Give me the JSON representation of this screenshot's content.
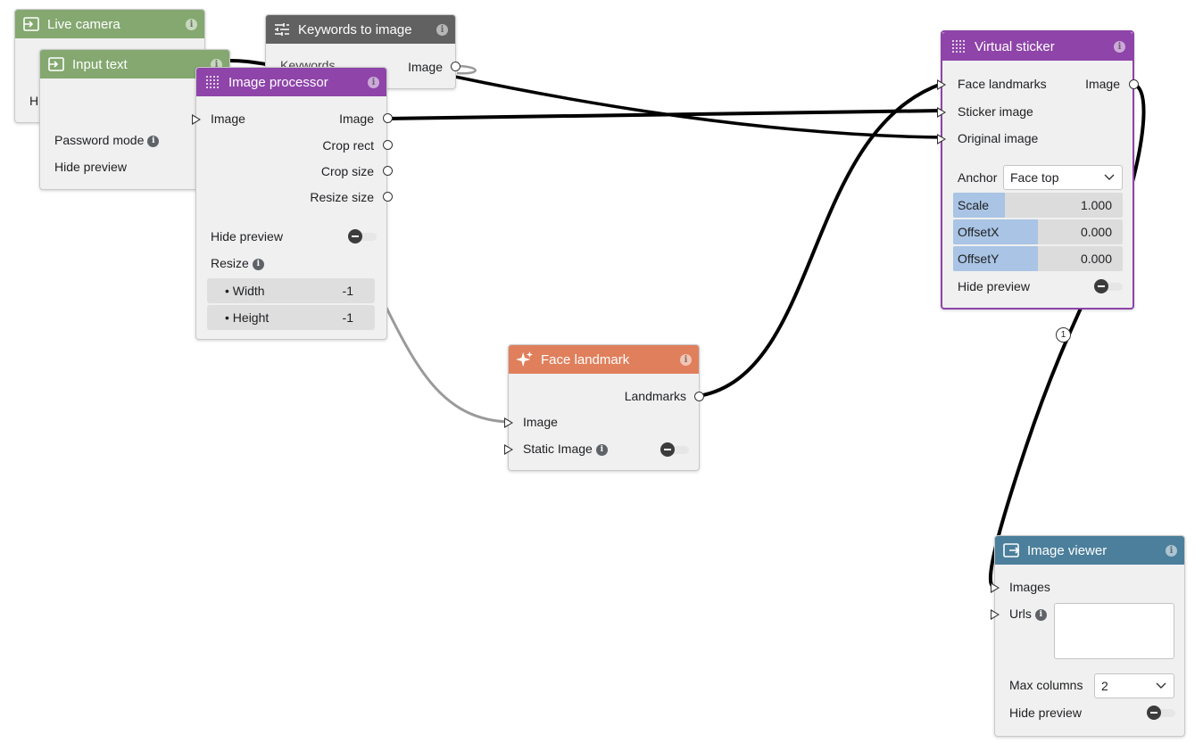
{
  "colors": {
    "input": "#84a870",
    "processor": "#8e44a9",
    "keywords": "#616161",
    "landmark": "#e07f5c",
    "viewer": "#4b7f9b"
  },
  "nodes": {
    "live_camera": {
      "title": "Live camera",
      "icon": "input-icon",
      "partial_label": "H"
    },
    "input_text": {
      "title": "Input text",
      "icon": "input-icon",
      "password_mode": "Password mode",
      "hide_preview": "Hide preview"
    },
    "keywords_to_image": {
      "title": "Keywords to image",
      "icon": "sliders-icon",
      "input_keywords": "Keywords",
      "output_image": "Image"
    },
    "image_processor": {
      "title": "Image processor",
      "icon": "grid-icon",
      "input_image": "Image",
      "outputs": [
        "Image",
        "Crop rect",
        "Crop size",
        "Resize size"
      ],
      "hide_preview": "Hide preview",
      "resize": "Resize",
      "width_label": "Width",
      "width_value": "-1",
      "height_label": "Height",
      "height_value": "-1"
    },
    "face_landmark": {
      "title": "Face landmark",
      "icon": "sparkle-icon",
      "output_landmarks": "Landmarks",
      "input_image": "Image",
      "static_image": "Static Image"
    },
    "virtual_sticker": {
      "title": "Virtual sticker",
      "icon": "grid-icon",
      "inputs": [
        "Face landmarks",
        "Sticker image",
        "Original image"
      ],
      "output_image": "Image",
      "anchor_label": "Anchor",
      "anchor_value": "Face top",
      "scale_label": "Scale",
      "scale_value": "1.000",
      "offsetx_label": "OffsetX",
      "offsetx_value": "0.000",
      "offsety_label": "OffsetY",
      "offsety_value": "0.000",
      "hide_preview": "Hide preview"
    },
    "image_viewer": {
      "title": "Image viewer",
      "icon": "output-icon",
      "input_images": "Images",
      "input_urls": "Urls",
      "max_columns_label": "Max columns",
      "max_columns_value": "2",
      "hide_preview": "Hide preview"
    }
  },
  "connection_badge": "1"
}
